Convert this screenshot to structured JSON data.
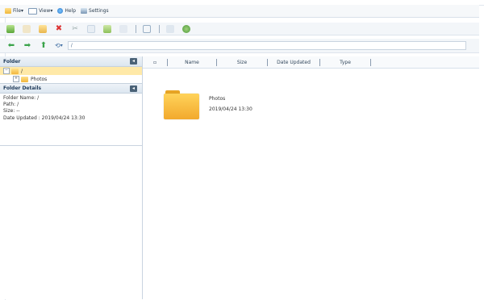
{
  "menu": {
    "file": "File",
    "view": "View",
    "help": "Help",
    "settings": "Settings"
  },
  "navigation": {
    "path": "/"
  },
  "folder_panel": {
    "title": "Folder",
    "root_label": "/",
    "child_label": "Photos"
  },
  "details_panel": {
    "title": "Folder Details",
    "name_line": "Folder Name: /",
    "path_line": "Path: /",
    "size_line": "Size: --",
    "updated_line": "Date Updated : 2019/04/24 13:30"
  },
  "columns": {
    "name": "Name",
    "size": "Size",
    "date": "Date Updated",
    "type": "Type"
  },
  "items": [
    {
      "name": "Photos",
      "date": "2019/04/24 13:30"
    }
  ]
}
